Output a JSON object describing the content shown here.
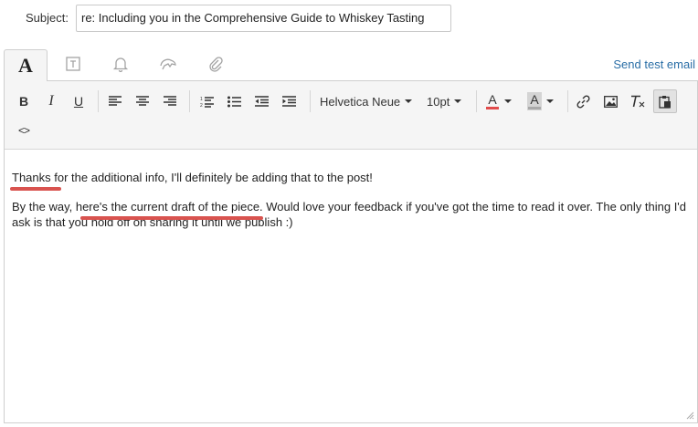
{
  "subject": {
    "label": "Subject:",
    "value": "re: Including you in the Comprehensive Guide to Whiskey Tasting"
  },
  "tabs": [
    {
      "name": "text",
      "icon": "text-format-icon",
      "glyph": "A",
      "active": true
    },
    {
      "name": "template",
      "icon": "template-icon"
    },
    {
      "name": "notifications",
      "icon": "bell-icon"
    },
    {
      "name": "tracking",
      "icon": "tracking-icon"
    },
    {
      "name": "attachments",
      "icon": "paperclip-icon"
    }
  ],
  "send_test_label": "Send test email",
  "toolbar": {
    "bold": "B",
    "italic": "I",
    "underline": "U",
    "font_family": "Helvetica Neue",
    "font_size": "10pt",
    "text_color_glyph": "A",
    "highlight_glyph": "A",
    "text_color_accent": "#e14b4b",
    "highlight_accent": "#a9a9a9",
    "source_code_glyph": "<>"
  },
  "body": {
    "paragraph1": "Thanks for the additional info, I'll definitely be adding that to the post!",
    "paragraph2": "By the way, here's the current draft of the piece. Would love your feedback if you've got the time to read it over. The only thing I'd ask is that you hold off on sharing it until we publish :)"
  },
  "colors": {
    "link": "#2a6ea6",
    "annotation": "#d9534f",
    "toolbar_bg": "#f5f5f5"
  }
}
